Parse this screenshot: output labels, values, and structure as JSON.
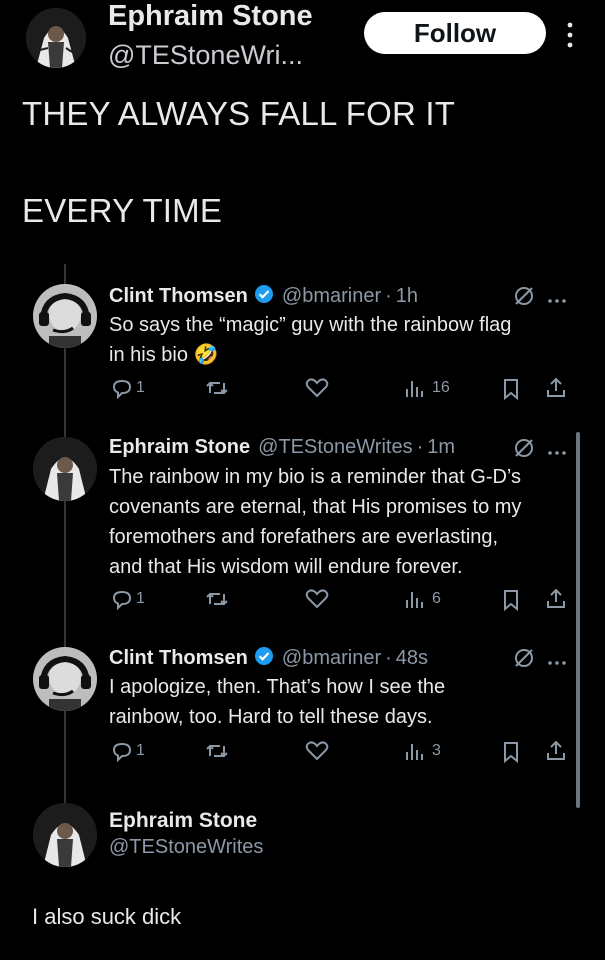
{
  "header": {
    "name": "Ephraim Stone",
    "handle": "@TEStoneWri...",
    "follow_label": "Follow",
    "more_icon": "vertical-dots-icon"
  },
  "post": {
    "line1": "THEY ALWAYS FALL FOR IT",
    "line2": "EVERY TIME"
  },
  "replies": [
    {
      "name": "Clint Thomsen",
      "verified": true,
      "handle": "@bmariner",
      "time": "1h",
      "body_lines": [
        "So says the “magic” guy with the rainbow flag",
        "in his bio 🤣"
      ],
      "replies": "1",
      "views": "16"
    },
    {
      "name": "Ephraim Stone",
      "verified": false,
      "handle": "@TEStoneWrites",
      "time": "1m",
      "body_lines": [
        "The rainbow in my bio is a reminder that G-D’s",
        "covenants are eternal, that His promises to my",
        "foremothers and forefathers are everlasting,",
        "and that His wisdom will endure forever."
      ],
      "replies": "1",
      "views": "6"
    },
    {
      "name": "Clint Thomsen",
      "verified": true,
      "handle": "@bmariner",
      "time": "48s",
      "body_lines": [
        "I apologize, then. That’s how I see the",
        "rainbow, too. Hard to tell these days."
      ],
      "replies": "1",
      "views": "3"
    }
  ],
  "final": {
    "name": "Ephraim Stone",
    "handle": "@TEStoneWrites",
    "text": "I also suck dick"
  },
  "colors": {
    "background": "#000000",
    "text": "#e7e9ea",
    "muted": "#8b98a5",
    "verified": "#1d9bf0"
  }
}
